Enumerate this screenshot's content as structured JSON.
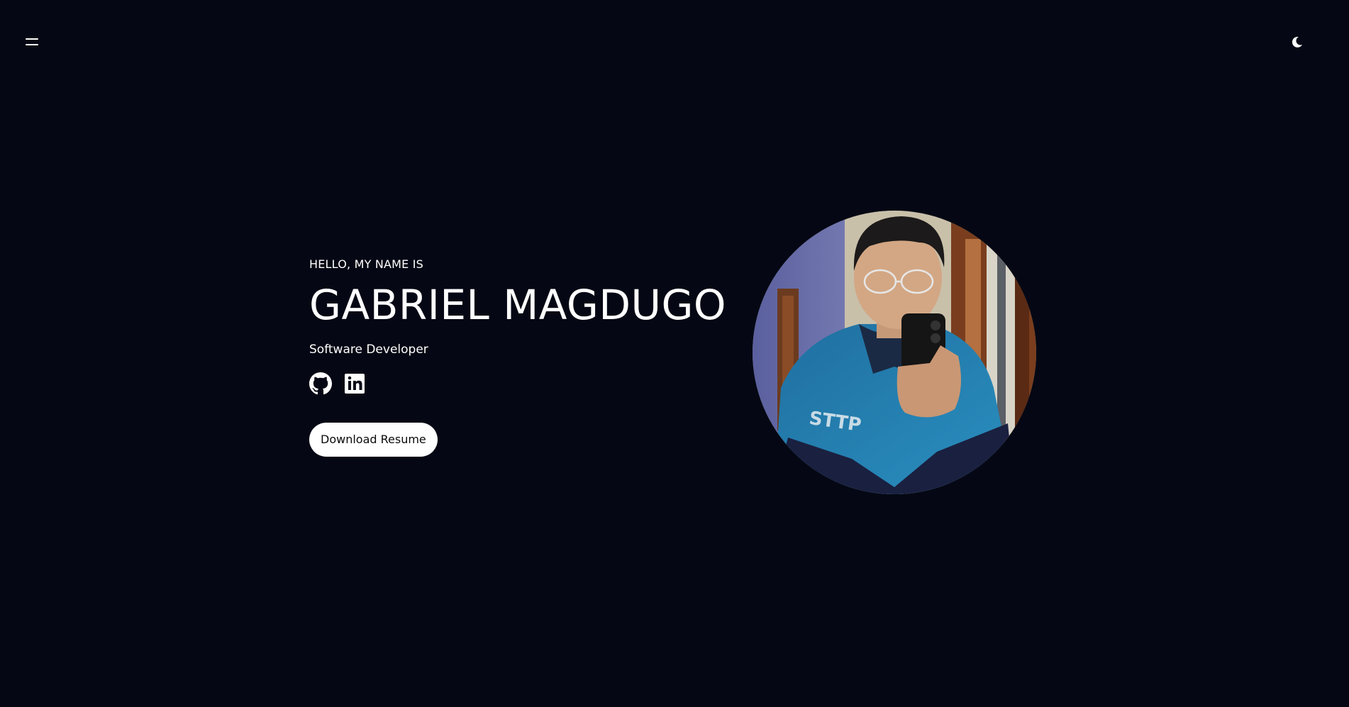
{
  "header": {
    "menu_icon": "hamburger-menu-icon",
    "theme_icon": "moon-icon"
  },
  "hero": {
    "greeting": "HELLO, MY NAME IS",
    "name": "GABRIEL MAGDUGO",
    "role": "Software Developer",
    "socials": [
      {
        "icon": "github-icon",
        "label": "GitHub"
      },
      {
        "icon": "linkedin-icon",
        "label": "LinkedIn"
      }
    ],
    "resume_button": "Download Resume",
    "avatar_jacket_text": "STTP"
  },
  "colors": {
    "background": "#050814",
    "text": "#ffffff",
    "button_bg": "#ffffff",
    "button_text": "#0a0a0a"
  }
}
